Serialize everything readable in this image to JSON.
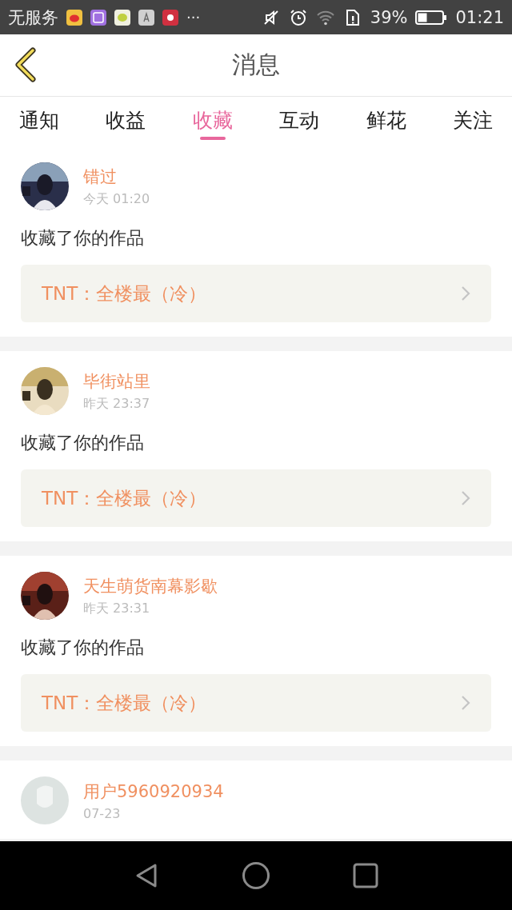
{
  "status_bar": {
    "carrier": "无服务",
    "more": "···",
    "battery_text": "39%",
    "time": "01:21"
  },
  "header": {
    "title": "消息"
  },
  "tabs": [
    {
      "label": "通知",
      "selected": false
    },
    {
      "label": "收益",
      "selected": false
    },
    {
      "label": "收藏",
      "selected": true
    },
    {
      "label": "互动",
      "selected": false
    },
    {
      "label": "鲜花",
      "selected": false
    },
    {
      "label": "关注",
      "selected": false
    }
  ],
  "messages": [
    {
      "kind": "picture",
      "name": "错过",
      "time": "今天 01:20",
      "action": "收藏了你的作品",
      "work": "TNT：全楼最（冷）"
    },
    {
      "kind": "picture",
      "name": "毕街站里",
      "time": "昨天 23:37",
      "action": "收藏了你的作品",
      "work": "TNT：全楼最（冷）"
    },
    {
      "kind": "picture",
      "name": "天生萌货南幕影歇",
      "time": "昨天 23:31",
      "action": "收藏了你的作品",
      "work": "TNT：全楼最（冷）"
    },
    {
      "kind": "default",
      "name": "用户5960920934",
      "time": "07-23"
    }
  ]
}
